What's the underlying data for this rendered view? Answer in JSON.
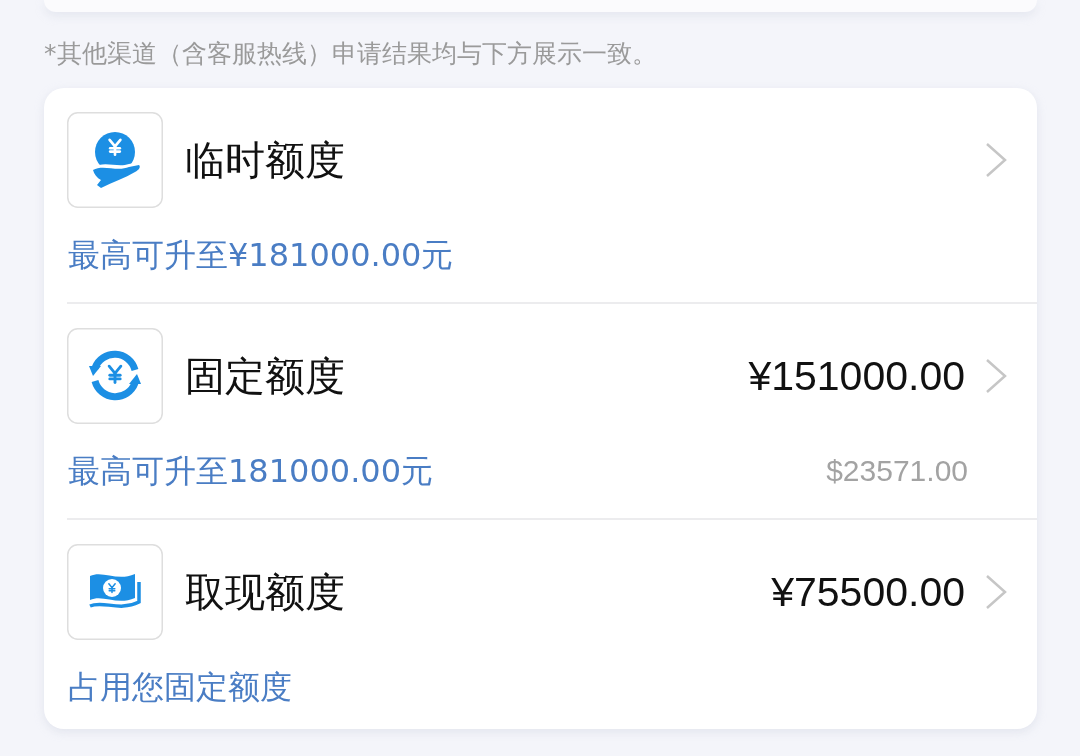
{
  "note": "*其他渠道（含客服热线）申请结果均与下方展示一致。",
  "items": [
    {
      "title": "临时额度",
      "subtitle": "最高可升至¥181000.00元"
    },
    {
      "title": "固定额度",
      "amount": "¥151000.00",
      "subtitle": "最高可升至181000.00元",
      "secondary_amount": "$23571.00"
    },
    {
      "title": "取现额度",
      "amount": "¥75500.00",
      "subtitle": "占用您固定额度"
    }
  ]
}
